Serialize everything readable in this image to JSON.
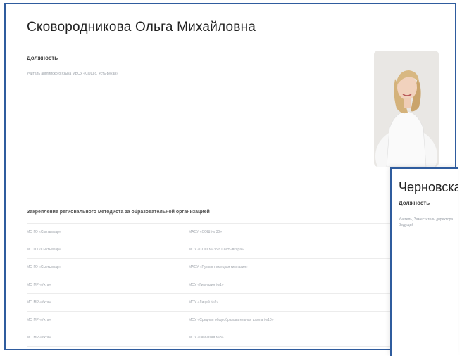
{
  "person": {
    "name": "Сковородникова Ольга Михайловна",
    "position_label": "Должность",
    "position_text": "Учитель английского языка МБОУ «СОШ с. Усть-Букан»"
  },
  "assignments": {
    "title": "Закрепление регионального методиста за образовательной организацией",
    "rows": [
      {
        "district": "МО ГО «Сыктывкар»",
        "org": "МАОУ «СОШ № 30»"
      },
      {
        "district": "МО ГО «Сыктывкар»",
        "org": "МОУ «СОШ № 35 г. Сыктывкара»"
      },
      {
        "district": "МО ГО «Сыктывкар»",
        "org": "МАОУ «Русско-немецкая гимназия»"
      },
      {
        "district": "МО МР «Ухта»",
        "org": "МОУ «Гимназия №1»"
      },
      {
        "district": "МО МР «Ухта»",
        "org": "МОУ «Лицей №6»"
      },
      {
        "district": "МО МР «Ухта»",
        "org": "МОУ «Средняя общеобразовательная школа №10»"
      },
      {
        "district": "МО МР «Ухта»",
        "org": "МОУ «Гимназия №3»"
      }
    ]
  },
  "next_card": {
    "name": "Черновская",
    "position_label": "Должность",
    "position_text_1": "Учитель, Заместитель директора",
    "position_text_2": "Ведущий"
  }
}
